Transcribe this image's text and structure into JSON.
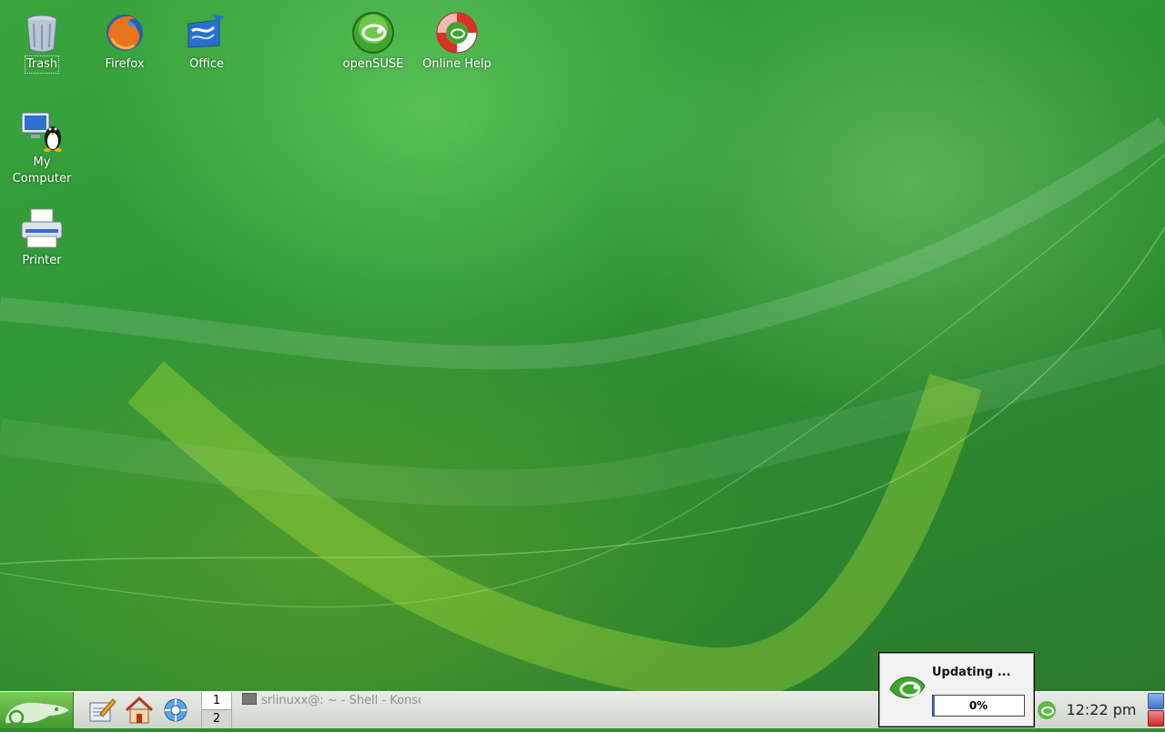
{
  "desktop": {
    "icons": [
      {
        "label": "Trash",
        "icon": "trash-icon"
      },
      {
        "label": "Firefox",
        "icon": "firefox-icon"
      },
      {
        "label": "Office",
        "icon": "office-icon"
      },
      {
        "label": "openSUSE",
        "icon": "opensuse-icon"
      },
      {
        "label": "Online Help",
        "icon": "lifebuoy-icon"
      },
      {
        "label": "My Computer",
        "icon": "computer-tux-icon"
      },
      {
        "label": "Printer",
        "icon": "printer-icon"
      }
    ]
  },
  "taskbar": {
    "start_icon": "opensuse-gecko-icon",
    "quick_launch": [
      "kwrite-icon",
      "home-icon",
      "konqueror-icon"
    ],
    "pager": [
      "1",
      "2"
    ],
    "task": "srlinuxx@: ~ - Shell - Konso",
    "clock": "12:22 pm",
    "tray_icons": [
      "opensuse-updater-icon",
      "lock-screen-icon",
      "logout-icon"
    ]
  },
  "popup": {
    "title": "Updating ...",
    "progress_text": "0%",
    "progress": 0.02
  },
  "colors": {
    "desktop_green": "#2e8b2e",
    "taskbar": "#dfe4dd",
    "progress_fill": "#3c6fc6"
  }
}
